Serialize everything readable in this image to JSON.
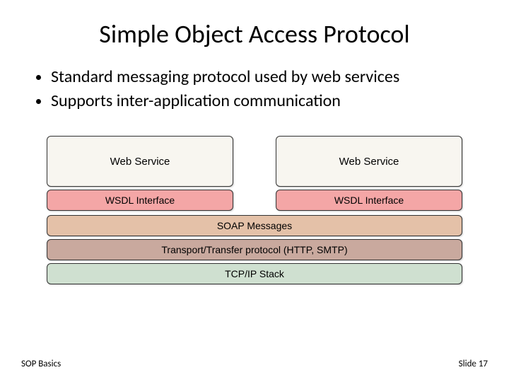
{
  "title": "Simple Object Access Protocol",
  "bullets": {
    "b0": "Standard messaging protocol used by web services",
    "b1": "Supports inter-application communication"
  },
  "diagram": {
    "left": {
      "service": "Web Service",
      "wsdl": "WSDL Interface"
    },
    "right": {
      "service": "Web Service",
      "wsdl": "WSDL Interface"
    },
    "soap": "SOAP Messages",
    "transport": "Transport/Transfer protocol (HTTP, SMTP)",
    "tcp": "TCP/IP Stack"
  },
  "footer": {
    "left": "SOP Basics",
    "right": "Slide 17"
  }
}
